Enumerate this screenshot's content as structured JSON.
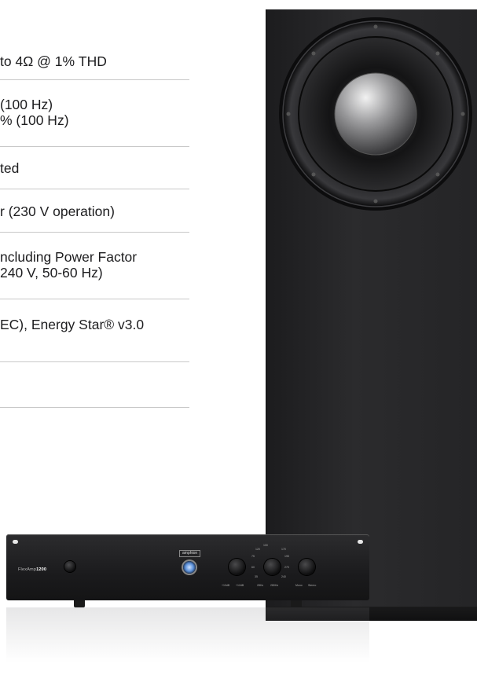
{
  "specs": [
    {
      "lines": [
        "to 4Ω @ 1% THD"
      ]
    },
    {
      "lines": [
        "(100 Hz)",
        "% (100 Hz)"
      ]
    },
    {
      "lines": [
        "ted"
      ]
    },
    {
      "lines": [
        "r (230 V operation)"
      ]
    },
    {
      "lines": [
        "ncluding Power Factor",
        "240 V, 50-60 Hz)"
      ]
    },
    {
      "lines": [
        "EC), Energy Star® v3.0"
      ]
    },
    {
      "lines": []
    }
  ],
  "amplifier": {
    "model_prefix": "FlexAmp",
    "model_number": "1200",
    "brand": "amphion",
    "knobs": [
      {
        "labels": [
          "+10dB",
          "+12dB"
        ]
      },
      {
        "labels": [
          "28Hz",
          "280Hz"
        ]
      },
      {
        "labels": [
          "Mono",
          "Stereo"
        ]
      }
    ],
    "freq_marks": [
      "100",
      "120",
      "170",
      "75",
      "195",
      "60",
      "270",
      "35",
      "240"
    ]
  },
  "colors": {
    "cabinet": "#242426",
    "divider": "#c8c8c8",
    "text": "#1d1d1f"
  }
}
